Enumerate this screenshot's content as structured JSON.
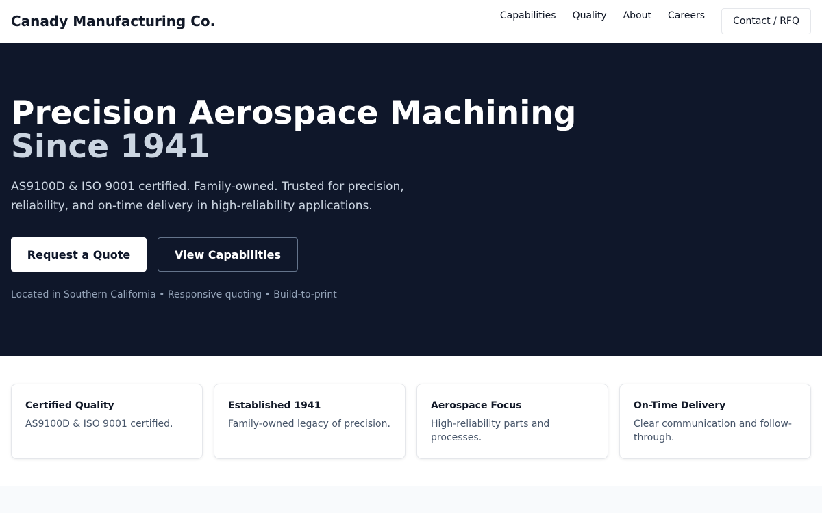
{
  "header": {
    "brand": "Canady Manufacturing Co.",
    "nav": [
      {
        "label": "Capabilities"
      },
      {
        "label": "Quality"
      },
      {
        "label": "About"
      },
      {
        "label": "Careers"
      }
    ],
    "cta_label": "Contact / RFQ"
  },
  "hero": {
    "title_line1": "Precision Aerospace Machining",
    "title_line2": "Since 1941",
    "subtitle": "AS9100D & ISO 9001 certified. Family-owned. Trusted for precision, reliability, and on-time delivery in high-reliability applications.",
    "primary_button": "Request a Quote",
    "secondary_button": "View Capabilities",
    "note": "Located in Southern California • Responsive quoting • Build-to-print"
  },
  "features": [
    {
      "title": "Certified Quality",
      "text": "AS9100D & ISO 9001 certified."
    },
    {
      "title": "Established 1941",
      "text": "Family-owned legacy of precision."
    },
    {
      "title": "Aerospace Focus",
      "text": "High-reliability parts and processes."
    },
    {
      "title": "On-Time Delivery",
      "text": "Clear communication and follow-through."
    }
  ],
  "colors": {
    "hero_bg": "#0f172a",
    "hero_accent_text": "#cbd5e1",
    "muted_text": "#94a3b8",
    "card_text": "#475569"
  }
}
